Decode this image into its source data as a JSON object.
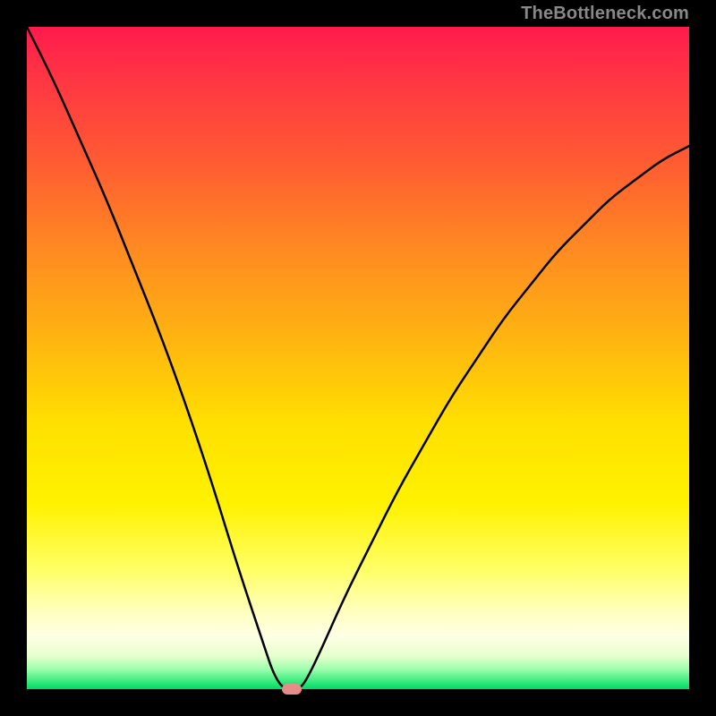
{
  "watermark": "TheBottleneck.com",
  "colors": {
    "frame": "#000000",
    "curve_stroke": "#000000",
    "marker_fill": "#e88b8b",
    "watermark_color": "#888888"
  },
  "chart_data": {
    "type": "line",
    "title": "",
    "xlabel": "",
    "ylabel": "",
    "xlim": [
      0,
      100
    ],
    "ylim": [
      0,
      100
    ],
    "grid": false,
    "legend": false,
    "annotations": [
      "TheBottleneck.com"
    ],
    "series": [
      {
        "name": "bottleneck-curve",
        "x": [
          0,
          4,
          8,
          12,
          16,
          20,
          24,
          28,
          32,
          36,
          37,
          38,
          39,
          40,
          41,
          42,
          44,
          48,
          52,
          56,
          60,
          64,
          68,
          72,
          76,
          80,
          84,
          88,
          92,
          96,
          100
        ],
        "values": [
          100,
          92,
          83,
          74,
          64,
          54,
          43,
          31,
          18,
          6,
          3,
          1,
          0,
          0,
          0,
          1,
          5,
          14,
          22,
          30,
          37,
          44,
          50,
          56,
          61,
          66,
          70,
          74,
          77,
          80,
          82
        ]
      }
    ],
    "marker": {
      "x": 40,
      "y": 0
    },
    "gradient_stops": [
      {
        "pos": 0.0,
        "color": "#ff1a4d"
      },
      {
        "pos": 0.07,
        "color": "#ff3344"
      },
      {
        "pos": 0.2,
        "color": "#ff5a33"
      },
      {
        "pos": 0.33,
        "color": "#ff8822"
      },
      {
        "pos": 0.47,
        "color": "#ffb411"
      },
      {
        "pos": 0.6,
        "color": "#ffe000"
      },
      {
        "pos": 0.72,
        "color": "#fff200"
      },
      {
        "pos": 0.82,
        "color": "#ffff66"
      },
      {
        "pos": 0.88,
        "color": "#ffffbb"
      },
      {
        "pos": 0.92,
        "color": "#ffffe6"
      },
      {
        "pos": 0.95,
        "color": "#e6ffcc"
      },
      {
        "pos": 0.97,
        "color": "#9cffad"
      },
      {
        "pos": 0.99,
        "color": "#30e87a"
      },
      {
        "pos": 1.0,
        "color": "#00d968"
      }
    ]
  }
}
